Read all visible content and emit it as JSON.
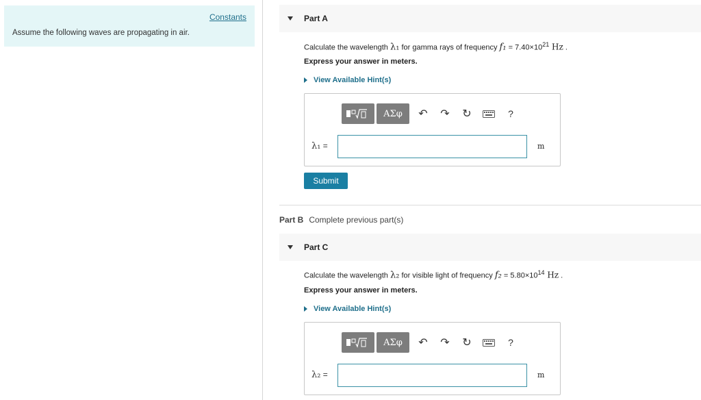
{
  "left": {
    "constants_label": "Constants",
    "intro": "Assume the following waves are propagating in air."
  },
  "partA": {
    "title": "Part A",
    "question_prefix": "Calculate the wavelength ",
    "sym": "λ₁",
    "question_mid": " for gamma rays of frequency ",
    "fsym": "f₁",
    "eq": " = ",
    "coef": "7.40×10",
    "exp": "21",
    "unit": " Hz",
    "end": " .",
    "express": "Express your answer in meters.",
    "hint": "View Available Hint(s)",
    "answer_label_sym": "λ₁",
    "answer_label_eq": " =",
    "answer_value": "",
    "answer_unit": "m",
    "submit": "Submit"
  },
  "partB": {
    "title": "Part B",
    "status": "Complete previous part(s)"
  },
  "partC": {
    "title": "Part C",
    "question_prefix": "Calculate the wavelength ",
    "sym": "λ₂",
    "question_mid": " for visible light of frequency ",
    "fsym": "f₂",
    "eq": " = ",
    "coef": "5.80×10",
    "exp": "14",
    "unit": " Hz",
    "end": " .",
    "express": "Express your answer in meters.",
    "hint": "View Available Hint(s)",
    "answer_label_sym": "λ₂",
    "answer_label_eq": " =",
    "answer_value": "",
    "answer_unit": "m"
  },
  "toolbar": {
    "greek": "ΑΣφ",
    "undo": "↶",
    "redo": "↷",
    "reset": "↻",
    "help": "?",
    "icons": [
      "templates-icon",
      "greek-icon",
      "undo-icon",
      "redo-icon",
      "reset-icon",
      "keyboard-icon",
      "help-icon"
    ]
  },
  "colors": {
    "accent": "#1a7fa3",
    "link": "#1f6f8b",
    "left_panel_bg": "#e4f6f7",
    "toolbar_button": "#7d7d7d"
  }
}
